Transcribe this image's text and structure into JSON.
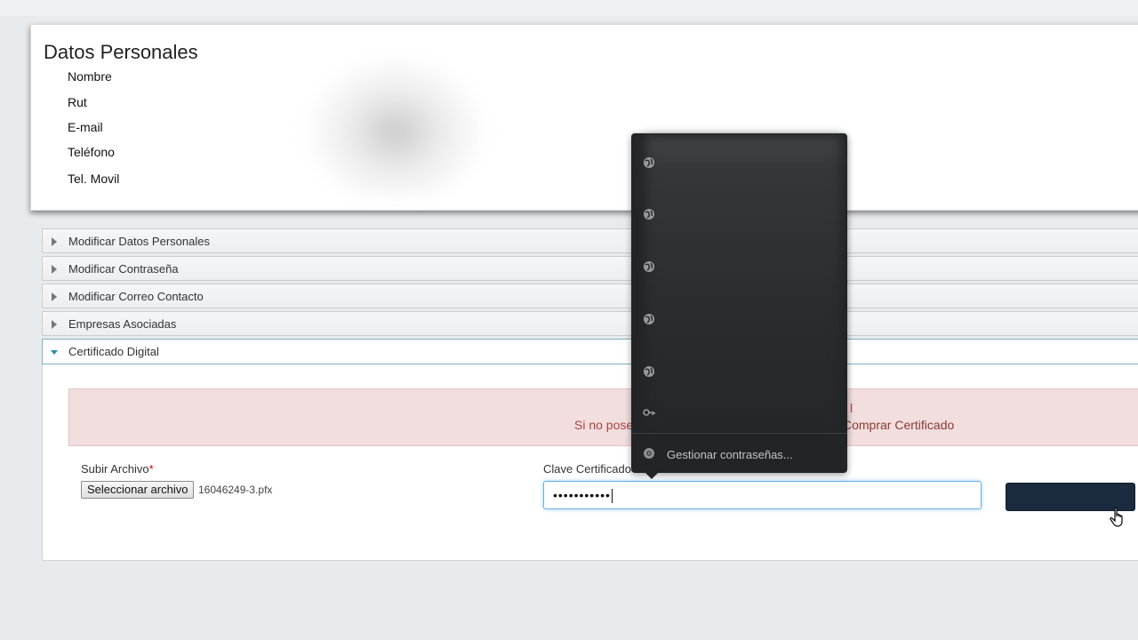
{
  "datos": {
    "title": "Datos Personales",
    "fields": [
      "Nombre",
      "Rut",
      "E-mail",
      "Teléfono",
      "Tel. Movil"
    ]
  },
  "accordion": [
    {
      "label": "Modificar Datos Personales"
    },
    {
      "label": "Modificar Contraseña"
    },
    {
      "label": "Modificar Correo Contacto"
    },
    {
      "label": "Empresas Asociadas"
    },
    {
      "label": "Certificado Digital"
    }
  ],
  "certificado": {
    "alert_line1_fragment": "l",
    "alert_line2_left": "Si no pose",
    "alert_line2_right": "Comprar Certificado",
    "upload_label": "Subir Archivo",
    "required_mark": "*",
    "file_button": "Seleccionar archivo",
    "file_name": "16046249-3.pfx",
    "password_label": "Clave Certificado",
    "password_value": "•••••••••••"
  },
  "password_popup": {
    "entry_icons": [
      "globe-icon",
      "globe-icon",
      "globe-icon",
      "globe-icon",
      "globe-icon",
      "key-icon"
    ],
    "manage_label": "Gestionar contraseñas..."
  },
  "colors": {
    "alert_bg": "#f2dede",
    "alert_text": "#a94442",
    "submit_button": "#1a2b3f",
    "popup_bg": "#232427"
  }
}
